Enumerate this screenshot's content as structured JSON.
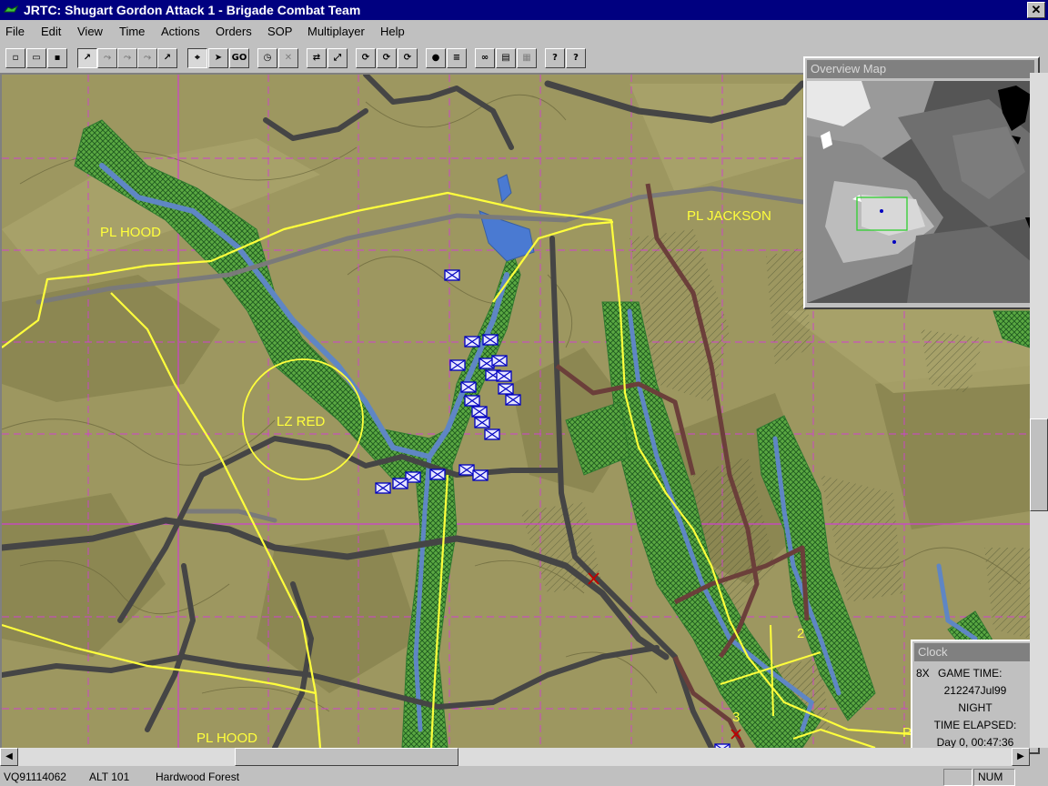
{
  "window": {
    "title": "JRTC: Shugart Gordon Attack 1 - Brigade Combat Team",
    "app_icon": "jrtc-app-icon",
    "close_glyph": "✕"
  },
  "menu": [
    "File",
    "Edit",
    "View",
    "Time",
    "Actions",
    "Orders",
    "SOP",
    "Multiplayer",
    "Help"
  ],
  "toolbar": {
    "go_label": "GO",
    "help_label": "?",
    "context_help_label": "?"
  },
  "map": {
    "labels": {
      "pl_hood_top": "PL HOOD",
      "pl_jackson": "PL JACKSON",
      "lz_red": "LZ RED",
      "pl_hood_bottom": "PL HOOD",
      "pl_partial": "P",
      "marker_2": "2",
      "marker_3": "3"
    },
    "colors": {
      "terrain": "#9d9760",
      "forest_dark": "#777c4a",
      "road": "#454545",
      "phase_line": "#ffff3c",
      "grid": "#d040d0",
      "river": "#5f86c4",
      "wetland": "#3f9a3f",
      "friendly_unit": "#0000c0"
    }
  },
  "overview": {
    "title": "Overview Map"
  },
  "clock": {
    "title": "Clock",
    "speed": "8X",
    "game_time_label": "GAME TIME:",
    "game_time": "212247Jul99",
    "light_condition": "NIGHT",
    "elapsed_label": "TIME ELAPSED:",
    "elapsed": "Day 0, 00:47:36"
  },
  "status": {
    "grid": "VQ91114062",
    "altitude": "ALT  101",
    "terrain": "Hardwood Forest",
    "num": "NUM"
  }
}
